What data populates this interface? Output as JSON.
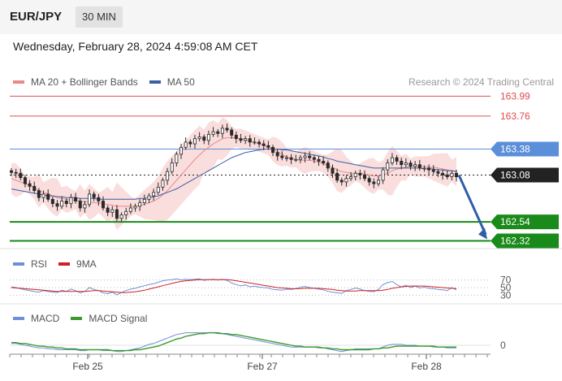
{
  "header": {
    "symbol": "EUR/JPY",
    "timeframe": "30 MIN",
    "datetime": "Wednesday, February 28, 2024 4:59:08 AM CET",
    "credit": "Research © 2024 Trading Central"
  },
  "legends": {
    "main": [
      {
        "label": "MA 20 + Bollinger Bands",
        "color": "#e88a8a"
      },
      {
        "label": "MA 50",
        "color": "#3b5fa3"
      }
    ],
    "rsi": [
      {
        "label": "RSI",
        "color": "#6f8fd6"
      },
      {
        "label": "9MA",
        "color": "#cc2222"
      }
    ],
    "macd": [
      {
        "label": "MACD",
        "color": "#6f8fd6"
      },
      {
        "label": "MACD Signal",
        "color": "#3a9a2a"
      }
    ]
  },
  "chart_data": {
    "type": "candlestick",
    "x_ticks": [
      "Feb 25",
      "Feb 27",
      "Feb 28"
    ],
    "ylim": [
      162.25,
      164.05
    ],
    "levels": [
      {
        "value": "163.99",
        "color": "#e04b4b",
        "style": "resistance"
      },
      {
        "value": "163.76",
        "color": "#e04b4b",
        "style": "resistance"
      },
      {
        "value": "163.38",
        "color": "#5b8fd9",
        "style": "pivot"
      },
      {
        "value": "163.08",
        "color": "#222222",
        "style": "last"
      },
      {
        "value": "162.54",
        "color": "#1a8a1a",
        "style": "support"
      },
      {
        "value": "162.32",
        "color": "#1a8a1a",
        "style": "support"
      }
    ],
    "close": [
      163.11,
      163.1,
      163.05,
      162.98,
      162.95,
      162.9,
      162.82,
      162.86,
      162.8,
      162.75,
      162.72,
      162.78,
      162.75,
      162.82,
      162.78,
      162.7,
      162.74,
      162.86,
      162.82,
      162.78,
      162.7,
      162.65,
      162.68,
      162.58,
      162.62,
      162.66,
      162.7,
      162.72,
      162.76,
      162.8,
      162.84,
      162.88,
      162.94,
      163.02,
      163.12,
      163.22,
      163.32,
      163.4,
      163.46,
      163.44,
      163.5,
      163.52,
      163.48,
      163.55,
      163.58,
      163.56,
      163.62,
      163.6,
      163.54,
      163.5,
      163.48,
      163.5,
      163.46,
      163.46,
      163.44,
      163.42,
      163.4,
      163.34,
      163.3,
      163.28,
      163.28,
      163.26,
      163.26,
      163.28,
      163.3,
      163.28,
      163.26,
      163.24,
      163.22,
      163.16,
      163.1,
      163.02,
      163.0,
      163.04,
      163.06,
      163.1,
      163.08,
      163.04,
      163.0,
      162.98,
      163.02,
      163.14,
      163.22,
      163.28,
      163.24,
      163.2,
      163.22,
      163.18,
      163.2,
      163.16,
      163.16,
      163.14,
      163.12,
      163.1,
      163.08,
      163.06,
      163.1,
      163.06
    ],
    "ma20": [
      163.04,
      163.02,
      163.0,
      162.98,
      162.96,
      162.93,
      162.9,
      162.88,
      162.86,
      162.84,
      162.82,
      162.81,
      162.8,
      162.79,
      162.79,
      162.78,
      162.77,
      162.77,
      162.76,
      162.76,
      162.75,
      162.74,
      162.73,
      162.72,
      162.72,
      162.72,
      162.72,
      162.72,
      162.73,
      162.74,
      162.76,
      162.78,
      162.81,
      162.85,
      162.9,
      162.96,
      163.02,
      163.08,
      163.14,
      163.2,
      163.26,
      163.31,
      163.36,
      163.4,
      163.44,
      163.47,
      163.5,
      163.51,
      163.51,
      163.51,
      163.5,
      163.49,
      163.47,
      163.46,
      163.44,
      163.42,
      163.4,
      163.38,
      163.35,
      163.32,
      163.29,
      163.27,
      163.26,
      163.25,
      163.25,
      163.25,
      163.24,
      163.23,
      163.21,
      163.19,
      163.17,
      163.14,
      163.12,
      163.11,
      163.1,
      163.1,
      163.1,
      163.09,
      163.08,
      163.07,
      163.07,
      163.08,
      163.1,
      163.13,
      163.15,
      163.16,
      163.17,
      163.18,
      163.18,
      163.18,
      163.18,
      163.17,
      163.17,
      163.16,
      163.15,
      163.14,
      163.13,
      163.12
    ],
    "ma50": [
      162.92,
      162.91,
      162.9,
      162.89,
      162.88,
      162.87,
      162.86,
      162.85,
      162.84,
      162.84,
      162.83,
      162.83,
      162.82,
      162.82,
      162.82,
      162.81,
      162.81,
      162.81,
      162.81,
      162.8,
      162.8,
      162.8,
      162.8,
      162.8,
      162.8,
      162.8,
      162.8,
      162.8,
      162.81,
      162.81,
      162.82,
      162.83,
      162.84,
      162.86,
      162.88,
      162.9,
      162.92,
      162.95,
      162.98,
      163.01,
      163.04,
      163.07,
      163.1,
      163.13,
      163.16,
      163.19,
      163.22,
      163.25,
      163.28,
      163.3,
      163.32,
      163.34,
      163.35,
      163.36,
      163.37,
      163.38,
      163.38,
      163.38,
      163.38,
      163.37,
      163.37,
      163.36,
      163.35,
      163.34,
      163.33,
      163.32,
      163.31,
      163.3,
      163.29,
      163.27,
      163.26,
      163.24,
      163.23,
      163.22,
      163.21,
      163.2,
      163.19,
      163.18,
      163.17,
      163.16,
      163.16,
      163.16,
      163.16,
      163.16,
      163.16,
      163.16,
      163.16,
      163.16,
      163.16,
      163.16,
      163.15,
      163.15,
      163.15,
      163.14,
      163.14,
      163.13,
      163.13,
      163.12
    ],
    "projection": {
      "from": 163.08,
      "to": 162.32
    },
    "rsi": {
      "levels": [
        "70",
        "50",
        "30"
      ],
      "rsi": [
        52,
        50,
        47,
        44,
        42,
        40,
        38,
        42,
        40,
        38,
        37,
        43,
        40,
        46,
        42,
        36,
        40,
        50,
        45,
        42,
        36,
        34,
        38,
        31,
        37,
        42,
        46,
        48,
        52,
        55,
        58,
        60,
        64,
        68,
        70,
        71,
        73,
        70,
        72,
        71,
        72,
        73,
        69,
        71,
        72,
        70,
        72,
        69,
        62,
        58,
        55,
        57,
        52,
        54,
        51,
        50,
        49,
        45,
        44,
        43,
        46,
        45,
        47,
        51,
        53,
        50,
        48,
        46,
        44,
        40,
        38,
        36,
        35,
        42,
        45,
        49,
        46,
        42,
        40,
        39,
        45,
        58,
        63,
        66,
        58,
        52,
        56,
        50,
        54,
        49,
        51,
        48,
        47,
        45,
        44,
        42,
        50,
        44
      ],
      "ma9": [
        50,
        49,
        48,
        47,
        46,
        45,
        44,
        43,
        42,
        41,
        40,
        40,
        40,
        40,
        40,
        40,
        40,
        41,
        42,
        42,
        41,
        40,
        39,
        38,
        37,
        37,
        38,
        39,
        41,
        43,
        46,
        49,
        52,
        55,
        58,
        61,
        64,
        66,
        68,
        69,
        70,
        71,
        71,
        71,
        71,
        71,
        71,
        71,
        70,
        68,
        66,
        64,
        62,
        60,
        58,
        56,
        54,
        52,
        50,
        49,
        48,
        47,
        47,
        47,
        48,
        48,
        48,
        48,
        47,
        46,
        45,
        43,
        42,
        41,
        41,
        41,
        42,
        42,
        42,
        42,
        42,
        43,
        45,
        48,
        50,
        52,
        53,
        54,
        54,
        54,
        54,
        53,
        52,
        51,
        50,
        49,
        48,
        47
      ]
    },
    "macd": {
      "zero_label": "0",
      "macd": [
        0.02,
        0.02,
        0.01,
        0.0,
        -0.01,
        -0.02,
        -0.03,
        -0.03,
        -0.04,
        -0.04,
        -0.05,
        -0.05,
        -0.05,
        -0.05,
        -0.05,
        -0.06,
        -0.06,
        -0.05,
        -0.05,
        -0.05,
        -0.06,
        -0.06,
        -0.06,
        -0.07,
        -0.07,
        -0.06,
        -0.05,
        -0.04,
        -0.03,
        -0.01,
        0.01,
        0.02,
        0.04,
        0.06,
        0.08,
        0.1,
        0.12,
        0.13,
        0.14,
        0.14,
        0.14,
        0.14,
        0.14,
        0.14,
        0.14,
        0.13,
        0.13,
        0.12,
        0.11,
        0.1,
        0.09,
        0.08,
        0.07,
        0.06,
        0.05,
        0.04,
        0.03,
        0.02,
        0.01,
        0.0,
        -0.01,
        -0.02,
        -0.02,
        -0.02,
        -0.02,
        -0.02,
        -0.02,
        -0.03,
        -0.03,
        -0.04,
        -0.05,
        -0.06,
        -0.07,
        -0.06,
        -0.05,
        -0.04,
        -0.04,
        -0.04,
        -0.04,
        -0.04,
        -0.04,
        -0.02,
        0.0,
        0.01,
        0.01,
        0.01,
        0.0,
        0.0,
        0.0,
        -0.01,
        -0.01,
        -0.01,
        -0.02,
        -0.02,
        -0.02,
        -0.03,
        -0.03,
        -0.03
      ],
      "signal": [
        0.03,
        0.03,
        0.02,
        0.02,
        0.01,
        0.0,
        -0.01,
        -0.01,
        -0.02,
        -0.02,
        -0.03,
        -0.03,
        -0.04,
        -0.04,
        -0.04,
        -0.05,
        -0.05,
        -0.05,
        -0.05,
        -0.05,
        -0.05,
        -0.05,
        -0.06,
        -0.06,
        -0.06,
        -0.06,
        -0.06,
        -0.05,
        -0.05,
        -0.04,
        -0.03,
        -0.02,
        -0.01,
        0.01,
        0.03,
        0.05,
        0.07,
        0.08,
        0.1,
        0.11,
        0.12,
        0.13,
        0.13,
        0.14,
        0.14,
        0.14,
        0.13,
        0.13,
        0.12,
        0.12,
        0.11,
        0.1,
        0.09,
        0.08,
        0.07,
        0.06,
        0.05,
        0.04,
        0.03,
        0.02,
        0.01,
        0.0,
        -0.01,
        -0.01,
        -0.02,
        -0.02,
        -0.02,
        -0.02,
        -0.03,
        -0.03,
        -0.04,
        -0.04,
        -0.05,
        -0.05,
        -0.05,
        -0.05,
        -0.05,
        -0.05,
        -0.05,
        -0.04,
        -0.04,
        -0.03,
        -0.03,
        -0.02,
        -0.01,
        -0.01,
        -0.01,
        -0.01,
        -0.01,
        -0.01,
        -0.01,
        -0.01,
        -0.01,
        -0.02,
        -0.02,
        -0.02,
        -0.02,
        -0.02
      ]
    }
  }
}
